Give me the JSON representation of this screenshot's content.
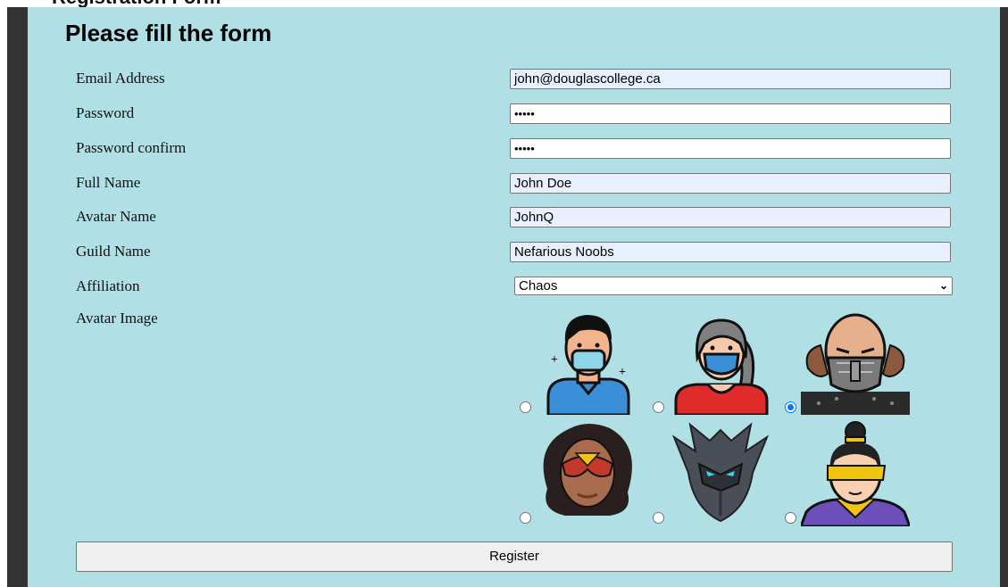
{
  "page": {
    "cut_heading": "Registration Form",
    "form_title": "Please fill the form"
  },
  "fields": {
    "email": {
      "label": "Email Address",
      "value": "john@douglascollege.ca"
    },
    "password": {
      "label": "Password",
      "value": "•••••"
    },
    "password_confirm": {
      "label": "Password confirm",
      "value": "•••••"
    },
    "full_name": {
      "label": "Full Name",
      "value": "John Doe"
    },
    "avatar_name": {
      "label": "Avatar Name",
      "value": "JohnQ"
    },
    "guild_name": {
      "label": "Guild Name",
      "value": "Nefarious Noobs"
    },
    "affiliation": {
      "label": "Affiliation",
      "value": "Chaos"
    },
    "avatar_image": {
      "label": "Avatar Image"
    }
  },
  "avatars": [
    {
      "name": "masked-man-avatar",
      "selected": false
    },
    {
      "name": "masked-woman-avatar",
      "selected": false
    },
    {
      "name": "bald-masked-ninja-avatar",
      "selected": true
    },
    {
      "name": "spider-woman-avatar",
      "selected": false
    },
    {
      "name": "dark-knight-helmet-avatar",
      "selected": false
    },
    {
      "name": "blindfolded-warrior-avatar",
      "selected": false
    }
  ],
  "actions": {
    "register_label": "Register"
  },
  "colors": {
    "panel_bg": "#b0e0e6",
    "sidebar": "#333333",
    "autofill_bg": "#e8f0fe",
    "radio_accent": "#0075ff"
  }
}
